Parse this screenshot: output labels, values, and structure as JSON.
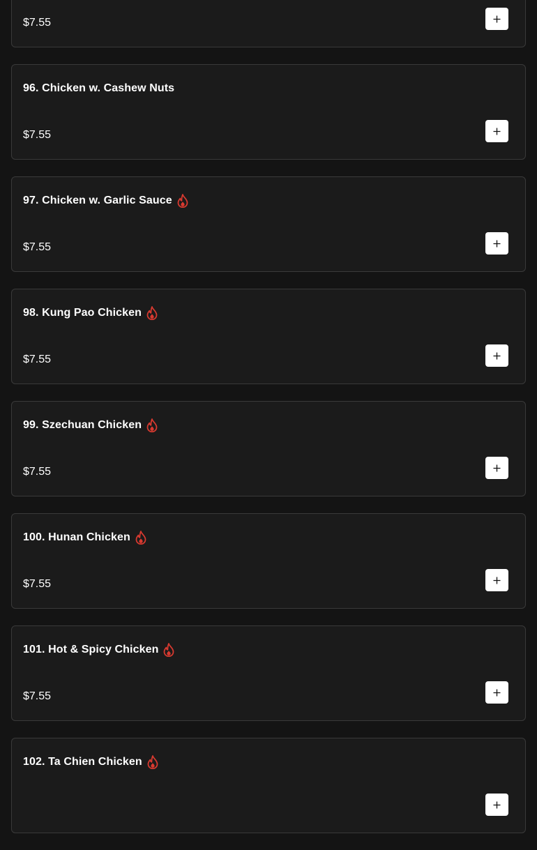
{
  "colors": {
    "background": "#141414",
    "card": "#1b1b1b",
    "border": "#3a3a3a",
    "spicy": "#d93a30",
    "button": "#ffffff"
  },
  "icons": {
    "spicy": "flame-icon",
    "add": "plus-icon"
  },
  "items": [
    {
      "name": "",
      "price": "$7.55",
      "spicy": false
    },
    {
      "name": "96. Chicken w. Cashew Nuts",
      "price": "$7.55",
      "spicy": false
    },
    {
      "name": "97. Chicken w. Garlic Sauce",
      "price": "$7.55",
      "spicy": true
    },
    {
      "name": "98. Kung Pao Chicken",
      "price": "$7.55",
      "spicy": true
    },
    {
      "name": "99. Szechuan Chicken",
      "price": "$7.55",
      "spicy": true
    },
    {
      "name": "100. Hunan Chicken",
      "price": "$7.55",
      "spicy": true
    },
    {
      "name": "101. Hot & Spicy Chicken",
      "price": "$7.55",
      "spicy": true
    },
    {
      "name": "102. Ta Chien Chicken",
      "price": "",
      "spicy": true
    }
  ]
}
